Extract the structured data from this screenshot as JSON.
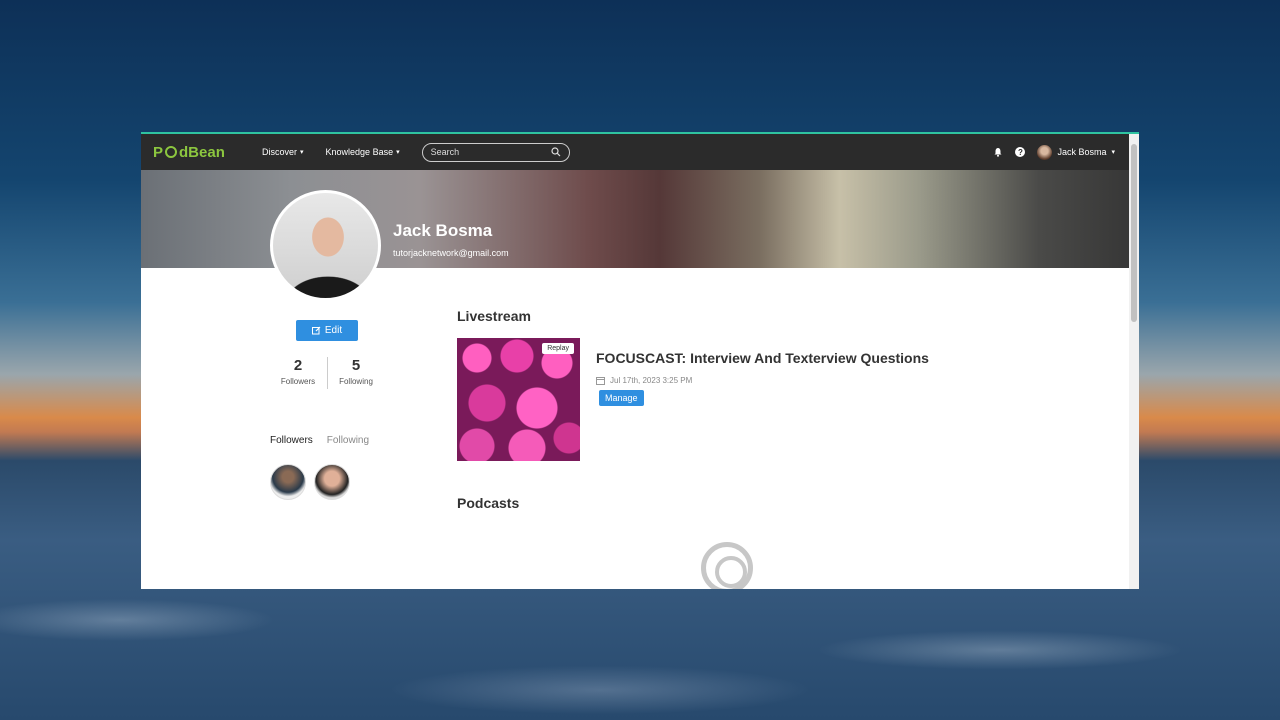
{
  "brand": {
    "logo": "PodBean",
    "logo_pre": "P",
    "logo_post": "dBean"
  },
  "nav": {
    "discover": "Discover",
    "knowledge_base": "Knowledge Base"
  },
  "search": {
    "placeholder": "Search"
  },
  "user": {
    "name": "Jack Bosma"
  },
  "profile": {
    "name": "Jack Bosma",
    "email": "tutorjacknetwork@gmail.com",
    "edit_label": "Edit",
    "followers_count": "2",
    "followers_label": "Followers",
    "following_count": "5",
    "following_label": "Following"
  },
  "tabs": {
    "followers": "Followers",
    "following": "Following"
  },
  "livestream": {
    "section_title": "Livestream",
    "badge": "Replay",
    "title": "FOCUSCAST: Interview And Texterview Questions",
    "date": "Jul 17th, 2023 3:25 PM",
    "manage_label": "Manage"
  },
  "podcasts": {
    "section_title": "Podcasts"
  },
  "icons": [
    "bell-icon",
    "help-icon",
    "search-icon",
    "edit-icon",
    "calendar-icon",
    "podcast-icon",
    "chevron-down-icon"
  ],
  "colors": {
    "accent": "#2f8fe0",
    "logo_green": "#8cc63f",
    "topbar": "#2b2b2b"
  }
}
